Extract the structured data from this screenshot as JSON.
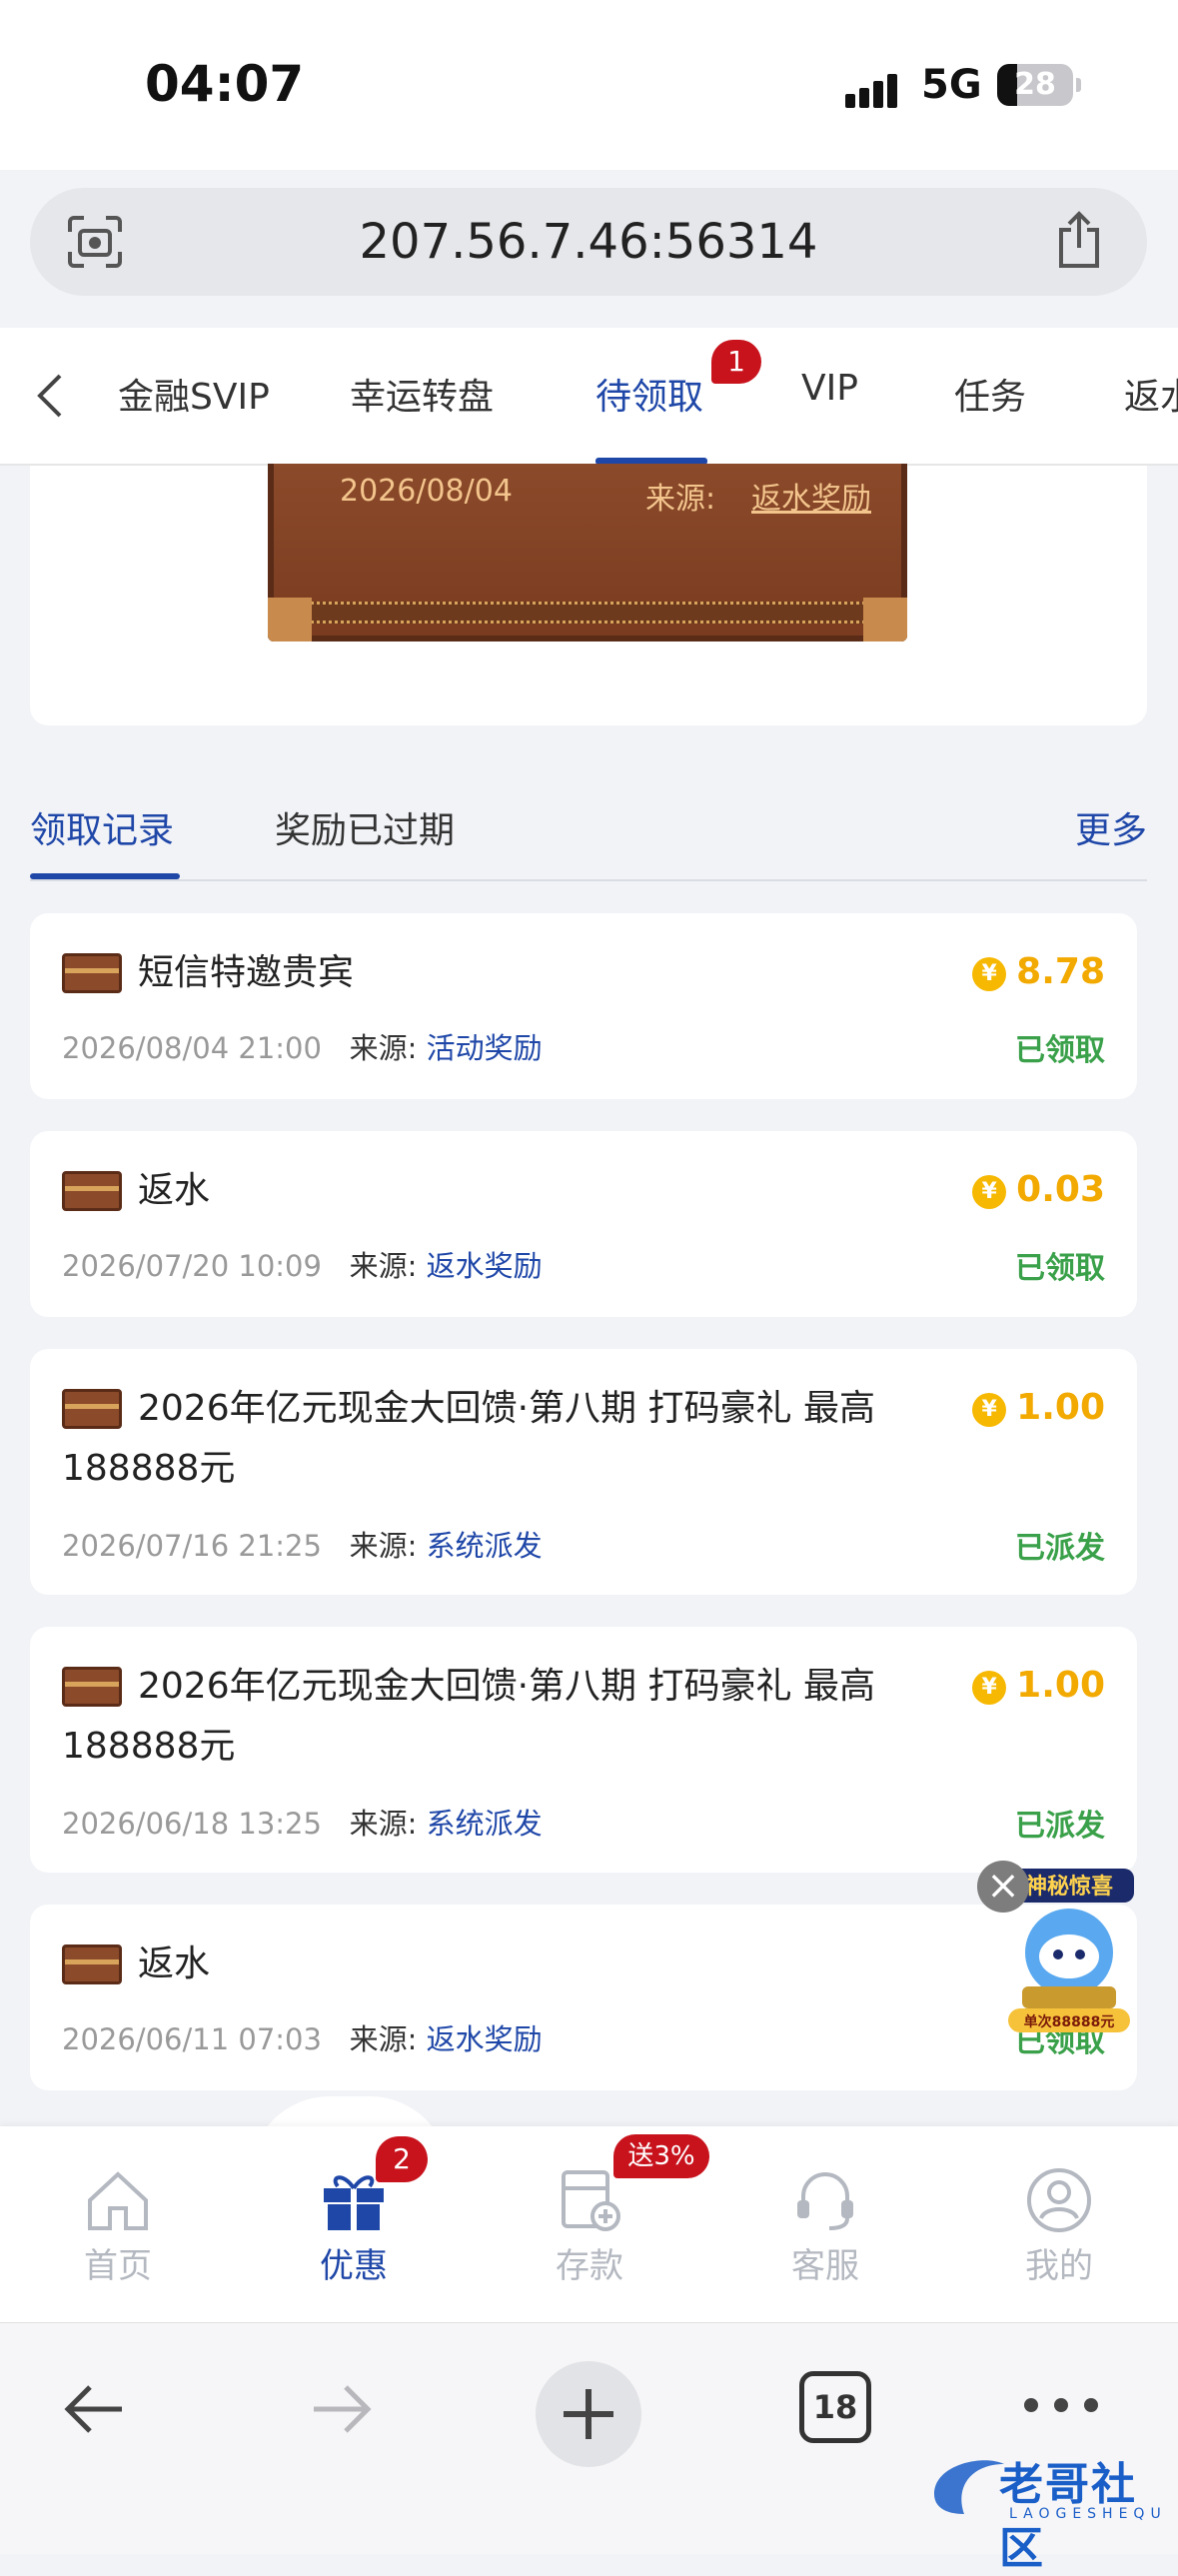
{
  "status": {
    "time": "04:07",
    "network": "5G",
    "battery": "28"
  },
  "browser": {
    "url": "207.56.7.46:56314"
  },
  "tabs": [
    {
      "label": "金融SVIP"
    },
    {
      "label": "幸运转盘"
    },
    {
      "label": "待领取",
      "badge": "1"
    },
    {
      "label": "VIP"
    },
    {
      "label": "任务"
    },
    {
      "label": "返水"
    }
  ],
  "chest_card": {
    "date": "2026/08/04",
    "source_label": "来源:",
    "source": "返水奖励"
  },
  "record_tabs": {
    "tab1": "领取记录",
    "tab2": "奖励已过期",
    "more": "更多"
  },
  "records": [
    {
      "title": "短信特邀贵宾",
      "time": "2026/08/04 21:00",
      "source_label": "来源:",
      "source": "活动奖励",
      "amount": "8.78",
      "status": "已领取"
    },
    {
      "title": "返水",
      "time": "2026/07/20 10:09",
      "source_label": "来源:",
      "source": "返水奖励",
      "amount": "0.03",
      "status": "已领取"
    },
    {
      "title": "2026年亿元现金大回馈·第八期 打码豪礼 最高188888元",
      "time": "2026/07/16 21:25",
      "source_label": "来源:",
      "source": "系统派发",
      "amount": "1.00",
      "status": "已派发"
    },
    {
      "title": "2026年亿元现金大回馈·第八期 打码豪礼 最高188888元",
      "time": "2026/06/18 13:25",
      "source_label": "来源:",
      "source": "系统派发",
      "amount": "1.00",
      "status": "已派发"
    },
    {
      "title": "返水",
      "time": "2026/06/11 07:03",
      "source_label": "来源:",
      "source": "返水奖励",
      "amount": "",
      "status": "已领取"
    }
  ],
  "promo": {
    "title": "神秘惊喜",
    "sub": "单次88888元"
  },
  "bottom_nav": [
    {
      "label": "首页"
    },
    {
      "label": "优惠",
      "badge": "2"
    },
    {
      "label": "存款",
      "badge": "送3%"
    },
    {
      "label": "客服"
    },
    {
      "label": "我的"
    }
  ],
  "toolbar": {
    "tab_count": "18"
  },
  "watermark": {
    "text": "老哥社区",
    "sub": "LAOGESHEQU"
  },
  "colors": {
    "accent": "#1f47a8",
    "gold": "#f2a900",
    "success": "#3aa14a",
    "badge": "#c8131d"
  }
}
